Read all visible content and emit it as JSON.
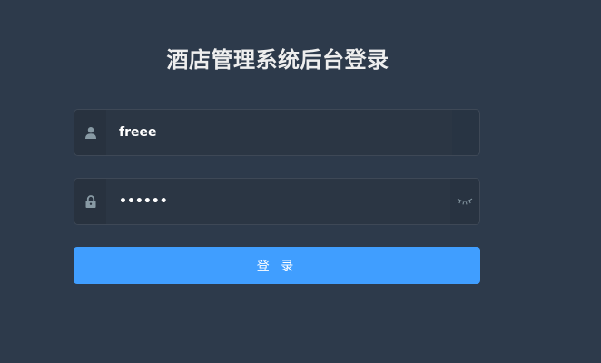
{
  "login": {
    "title": "酒店管理系统后台登录",
    "username": {
      "value": "freee",
      "icon": "user-icon"
    },
    "password": {
      "value": "••••••",
      "icon": "lock-icon",
      "toggle_icon": "eye-closed-icon"
    },
    "submit_label": "登 录"
  },
  "colors": {
    "background": "#2d3a4b",
    "title_text": "#eeeeee",
    "button": "#409eff",
    "icon": "#889aa4"
  }
}
